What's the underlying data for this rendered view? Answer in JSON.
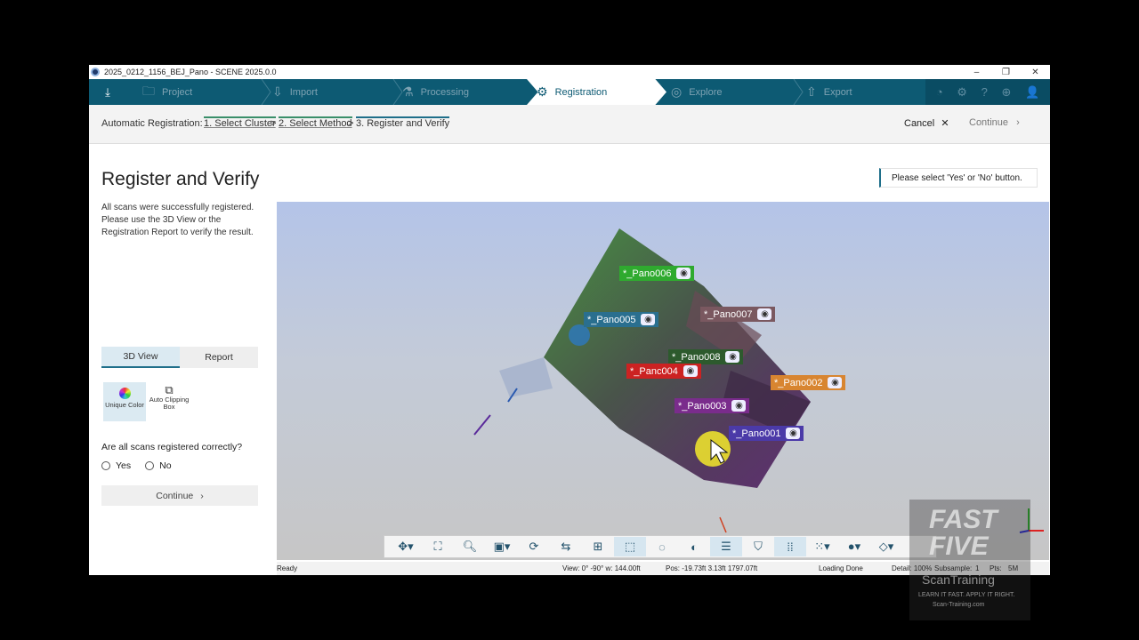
{
  "window": {
    "title": "2025_0212_1156_BEJ_Pano - SCENE 2025.0.0",
    "minimize": "–",
    "restore": "❐",
    "close": "✕"
  },
  "workflow": {
    "steps": [
      {
        "label": "Project",
        "icon": "folder-icon"
      },
      {
        "label": "Import",
        "icon": "import-icon"
      },
      {
        "label": "Processing",
        "icon": "processing-icon"
      },
      {
        "label": "Registration",
        "icon": "registration-icon"
      },
      {
        "label": "Explore",
        "icon": "explore-icon"
      },
      {
        "label": "Export",
        "icon": "export-icon"
      }
    ],
    "active": "Registration"
  },
  "breadcrumb": {
    "lead": "Automatic Registration:",
    "step1": "1. Select Cluster",
    "step2": "2. Select Method",
    "step3": "3. Register and Verify",
    "sep": ">",
    "cancel": "Cancel",
    "continue": "Continue"
  },
  "left_panel": {
    "title": "Register and Verify",
    "description": "All scans were successfully registered. Please use the 3D View or the Registration Report to verify the result.",
    "tabs": [
      "3D View",
      "Report"
    ],
    "tools": [
      {
        "label": "Unique Color",
        "icon": "color-wheel-icon"
      },
      {
        "label": "Auto Clipping Box",
        "icon": "clipping-box-icon"
      }
    ],
    "question": "Are all scans registered correctly?",
    "yes": "Yes",
    "no": "No",
    "continue": "Continue"
  },
  "notice": "Please select 'Yes' or 'No' button.",
  "viewport": {
    "scans": [
      {
        "name": "*_Pano006",
        "color": "#2faa2f"
      },
      {
        "name": "*_Pano005",
        "color": "#2a6f8f"
      },
      {
        "name": "*_Pano007",
        "color": "#7a5860"
      },
      {
        "name": "*_Pano008",
        "color": "#2d5a2d"
      },
      {
        "name": "*_Panc004",
        "color": "#cc2222"
      },
      {
        "name": "*_Pano002",
        "color": "#d88530"
      },
      {
        "name": "*_Pano003",
        "color": "#7a2c8c"
      },
      {
        "name": "*_Pano001",
        "color": "#4b3aa8"
      }
    ]
  },
  "status": {
    "ready": "Ready",
    "view": "View: 0° -90° w: 144.00ft",
    "pos": "Pos: -19.73ft 3.13ft 1797.07ft",
    "loading": "Loading Done",
    "detail": "Detail: 100%",
    "subsample": "Subsample:",
    "subsample_val": "1",
    "pts": "Pts:",
    "pts_val": "5M"
  },
  "watermark": {
    "line1": "FAST",
    "line2": "FIVE",
    "brand": "ScanTraining",
    "tagline": "LEARN IT FAST. APPLY IT RIGHT.",
    "url": "Scan-Training.com"
  },
  "colors": {
    "accent": "#0d5a73",
    "highlight": "#f5ea2a"
  }
}
